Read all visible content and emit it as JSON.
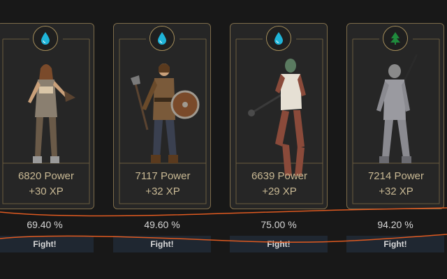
{
  "colors": {
    "accent_gold": "#a28b59",
    "stat_text": "#c9b994",
    "water": "#1fb4d8",
    "nature": "#1f8a3c",
    "annotation": "#e05a20"
  },
  "opponents": [
    {
      "element_icon": "water-drop-icon",
      "power": "6820 Power",
      "xp": "+30 XP",
      "chance": "69.40 %",
      "fight_label": "Fight!"
    },
    {
      "element_icon": "water-drop-icon",
      "power": "7117 Power",
      "xp": "+32 XP",
      "chance": "49.60 %",
      "fight_label": "Fight!"
    },
    {
      "element_icon": "water-drop-icon",
      "power": "6639 Power",
      "xp": "+29 XP",
      "chance": "75.00 %",
      "fight_label": "Fight!"
    },
    {
      "element_icon": "tree-icon",
      "power": "7214 Power",
      "xp": "+32 XP",
      "chance": "94.20 %",
      "fight_label": "Fight!"
    }
  ]
}
